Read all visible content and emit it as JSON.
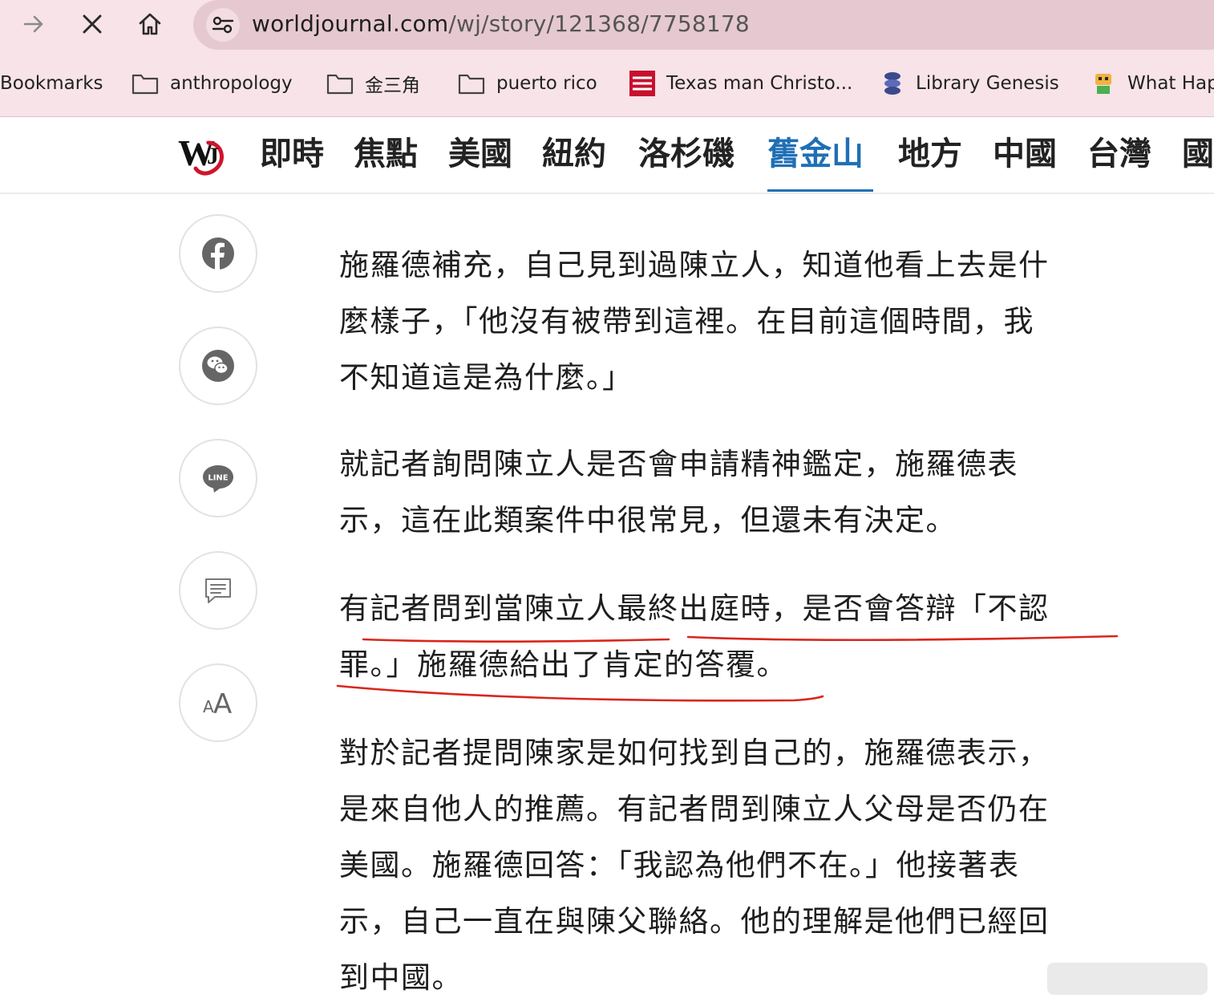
{
  "browser": {
    "url_host": "worldjournal.com",
    "url_path": "/wj/story/121368/7758178",
    "bookmarks": [
      {
        "label": "Bookmarks",
        "icon": "none"
      },
      {
        "label": "anthropology",
        "icon": "folder-icon"
      },
      {
        "label": "金三角",
        "icon": "folder-icon"
      },
      {
        "label": "puerto rico",
        "icon": "folder-icon"
      },
      {
        "label": "Texas man Christo...",
        "icon": "new-york-post-icon"
      },
      {
        "label": "Library Genesis",
        "icon": "library-genesis-icon"
      },
      {
        "label": "What Hap",
        "icon": "robot-favicon-icon"
      }
    ]
  },
  "site": {
    "logo_text": "WJ",
    "nav": [
      "即時",
      "焦點",
      "美國",
      "紐約",
      "洛杉磯",
      "舊金山",
      "地方",
      "中國",
      "台灣",
      "國"
    ],
    "active_nav": "舊金山",
    "accent": "#1f6fb5"
  },
  "share": [
    "facebook-icon",
    "wechat-icon",
    "line-icon",
    "comment-icon",
    "font-size-icon"
  ],
  "share_line_label": "LINE",
  "share_font_label_small": "A",
  "share_font_label_large": "A",
  "article": {
    "paragraphs": [
      [
        "施羅德補充，自己見到過陳立人，知道他看上去是什",
        "麼樣子，「他沒有被帶到這裡。在目前這個時間，我",
        "不知道這是為什麼。」"
      ],
      [
        "就記者詢問陳立人是否會申請精神鑑定，施羅德表",
        "示，這在此類案件中很常見，但還未有決定。"
      ],
      [
        "有記者問到當陳立人最終出庭時，是否會答辯「不認",
        "罪。」施羅德給出了肯定的答覆。"
      ],
      [
        "對於記者提問陳家是如何找到自己的，施羅德表示，",
        "是來自他人的推薦。有記者問到陳立人父母是否仍在",
        "美國。施羅德回答：「我認為他們不在。」他接著表",
        "示，自己一直在與陳父聯絡。他的理解是他們已經回",
        "到中國。"
      ]
    ],
    "annotation_color": "#d9261c"
  }
}
